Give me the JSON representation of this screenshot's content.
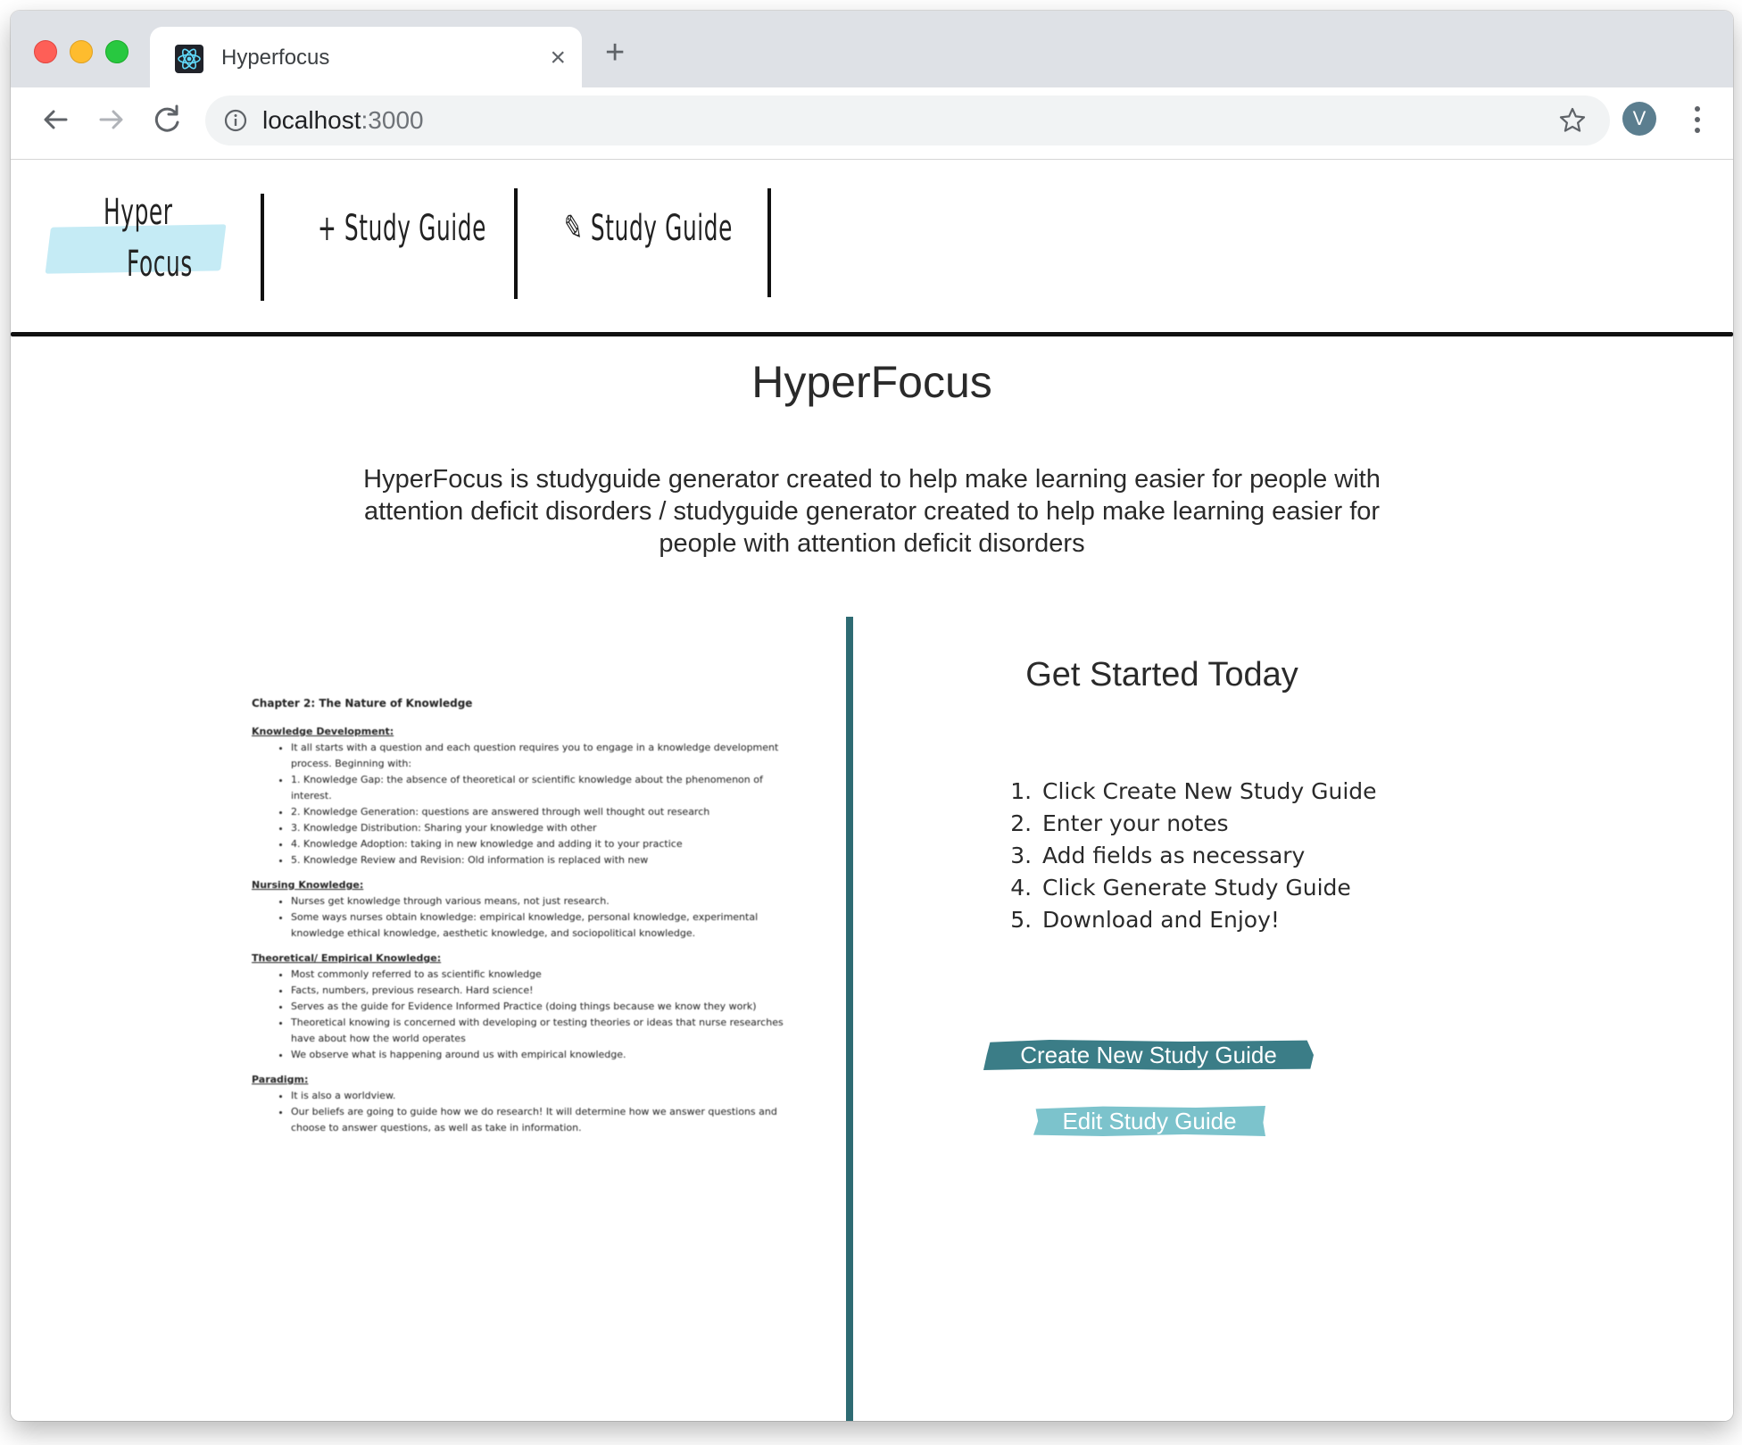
{
  "browser": {
    "tab_title": "Hyperfocus",
    "tab_close": "×",
    "new_tab": "+",
    "url_host": "localhost",
    "url_port": ":3000",
    "avatar_initial": "V"
  },
  "nav": {
    "logo_line1": "Hyper",
    "logo_line2": "Focus",
    "create_link": "+ Study Guide",
    "edit_link": "Study Guide"
  },
  "hero": {
    "title": "HyperFocus",
    "description": "HyperFocus is studyguide generator created to help make learning easier for people with attention deficit disorders / studyguide generator created to help make learning easier for people with attention deficit disorders"
  },
  "notes_preview": {
    "title": "Chapter 2: The Nature of Knowledge",
    "sections": [
      {
        "heading": "Knowledge Development:",
        "items": [
          "It all starts with a question and each question requires you to engage in a knowledge development process. Beginning with:",
          "1. Knowledge Gap: the absence of theoretical or scientific knowledge about the phenomenon of interest.",
          "2. Knowledge Generation: questions are answered through well thought out research",
          "3. Knowledge Distribution: Sharing your knowledge with other",
          "4. Knowledge Adoption: taking in new knowledge and adding it to your practice",
          "5. Knowledge Review and Revision: Old information is replaced with new"
        ]
      },
      {
        "heading": "Nursing Knowledge:",
        "items": [
          "Nurses get knowledge through various means, not just research.",
          "Some ways nurses obtain knowledge: empirical knowledge, personal knowledge, experimental knowledge ethical knowledge, aesthetic knowledge, and sociopolitical knowledge."
        ]
      },
      {
        "heading": "Theoretical/ Empirical Knowledge:",
        "items": [
          "Most commonly referred to as scientific knowledge",
          "Facts, numbers, previous research. Hard science!",
          "Serves as the guide for Evidence Informed Practice (doing things because we know they work)",
          "Theoretical knowing is concerned with developing or testing theories or ideas that nurse researches have about how the world operates",
          "We observe what is happening around us with empirical knowledge."
        ]
      },
      {
        "heading": "Paradigm:",
        "items": [
          "It is also a worldview.",
          "Our beliefs are going to guide how we do research! It will determine how we answer questions and choose to answer questions, as well as take in information."
        ]
      }
    ]
  },
  "get_started": {
    "heading": "Get Started Today",
    "steps": [
      "Click Create New Study Guide",
      "Enter your notes",
      "Add fields as necessary",
      "Click Generate Study Guide",
      "Download and Enjoy!"
    ],
    "create_button": "Create New Study Guide",
    "edit_button": "Edit Study Guide"
  },
  "colors": {
    "accent_dark": "#3b7d87",
    "accent_light": "#7cc3cc",
    "divider": "#2e6b73",
    "logo_swash": "#c5ebf5"
  }
}
